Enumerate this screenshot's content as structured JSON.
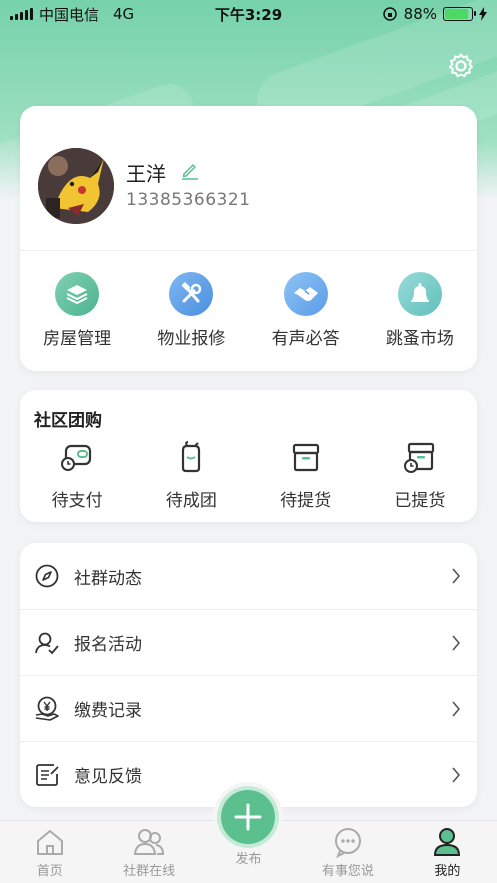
{
  "status_bar": {
    "carrier": "中国电信",
    "network": "4G",
    "time": "下午3:29",
    "battery": "88%",
    "battery_level": 0.88
  },
  "profile": {
    "name": "王洋",
    "phone": "13385366321"
  },
  "quick_actions": [
    {
      "label": "房屋管理",
      "icon": "house-layers-icon"
    },
    {
      "label": "物业报修",
      "icon": "wrench-hammer-icon"
    },
    {
      "label": "有声必答",
      "icon": "handshake-icon"
    },
    {
      "label": "跳蚤市场",
      "icon": "bell-icon"
    }
  ],
  "group_buy": {
    "title": "社区团购",
    "items": [
      {
        "label": "待支付",
        "icon": "wallet-clock-icon"
      },
      {
        "label": "待成团",
        "icon": "bag-icon"
      },
      {
        "label": "待提货",
        "icon": "box-icon"
      },
      {
        "label": "已提货",
        "icon": "box-clock-icon"
      }
    ]
  },
  "menu": [
    {
      "label": "社群动态",
      "icon": "compass-icon"
    },
    {
      "label": "报名活动",
      "icon": "user-check-icon"
    },
    {
      "label": "缴费记录",
      "icon": "yen-hand-icon"
    },
    {
      "label": "意见反馈",
      "icon": "feedback-icon"
    }
  ],
  "tabs": [
    {
      "label": "首页",
      "icon": "home-icon"
    },
    {
      "label": "社群在线",
      "icon": "group-icon"
    },
    {
      "label": "发布",
      "icon": "plus-icon"
    },
    {
      "label": "有事您说",
      "icon": "chat-icon"
    },
    {
      "label": "我的",
      "icon": "profile-icon"
    }
  ],
  "colors": {
    "accent": "#5bbf8e",
    "header": "#76d2aa"
  }
}
